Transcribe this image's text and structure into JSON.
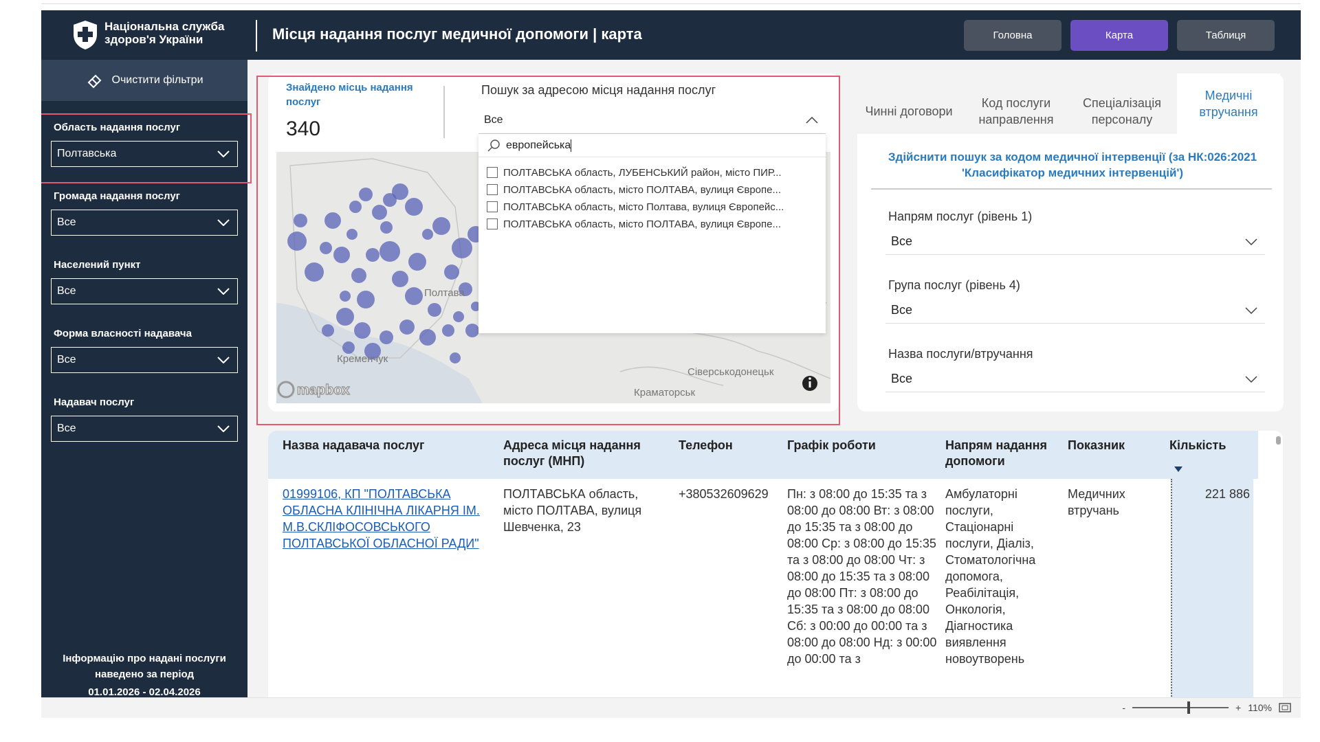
{
  "header": {
    "org_name": "Національна служба здоров'я України",
    "title": "Місця надання послуг медичної допомоги | карта",
    "nav": [
      "Головна",
      "Карта",
      "Таблиця"
    ],
    "active_nav": "Карта"
  },
  "sidebar": {
    "clear_filters": "Очистити фільтри",
    "filters": [
      {
        "label": "Область надання послуг",
        "value": "Полтавська"
      },
      {
        "label": "Громада надання послуг",
        "value": "Все"
      },
      {
        "label": "Населений пункт",
        "value": "Все"
      },
      {
        "label": "Форма власності надавача",
        "value": "Все"
      },
      {
        "label": "Надавач послуг",
        "value": "Все"
      }
    ],
    "period_label": "Інформацію про надані послуги наведено за період",
    "period_value": "01.01.2026 - 02.04.2026"
  },
  "map": {
    "found_label": "Знайдено місць надання послуг",
    "found_value": "340",
    "place_labels": [
      "Полтава",
      "Кременчук",
      "Сіверськодонецьк",
      "Краматорськ"
    ],
    "attribution": "mapbox"
  },
  "address_search": {
    "title": "Пошук за адресою місця надання послуг",
    "selected": "Все",
    "query": "европейська",
    "options": [
      "ПОЛТАВСЬКА область, ЛУБЕНСЬКИЙ район, місто ПИР...",
      "ПОЛТАВСЬКА область, місто ПОЛТАВА, вулиця Європе...",
      "ПОЛТАВСЬКА область, місто Полтава, вулиця Європейс...",
      "ПОЛТАВСЬКА область, місто ПОЛТАВА, вулиця Європе..."
    ]
  },
  "right_panel": {
    "tabs": [
      "Чинні договори",
      "Код послуги направлення",
      "Спеціалізація персоналу",
      "Медичні втручання"
    ],
    "active_tab": "Медичні втручання",
    "code_search": "Здійснити пошук за кодом медичної інтервенції (за НК:026:2021 'Класифікатор медичних інтервенцій')",
    "filters": [
      {
        "label": "Напрям послуг (рівень 1)",
        "value": "Все"
      },
      {
        "label": "Група послуг (рівень 4)",
        "value": "Все"
      },
      {
        "label": "Назва послуги/втручання",
        "value": "Все"
      }
    ]
  },
  "table": {
    "columns": [
      "Назва надавача послуг",
      "Адреса місця надання послуг (МНП)",
      "Телефон",
      "Графік роботи",
      "Напрям надання допомоги",
      "Показник",
      "Кількість"
    ],
    "rows": [
      {
        "provider": "01999106, КП \"ПОЛТАВСЬКА ОБЛАСНА КЛІНІЧНА ЛІКАРНЯ ІМ. М.В.СКЛІФОСОВСЬКОГО ПОЛТАВСЬКОЇ ОБЛАСНОЇ РАДИ\"",
        "address": "ПОЛТАВСЬКА область, місто ПОЛТАВА, вулиця Шевченка, 23",
        "phone": "+380532609629",
        "schedule": "Пн: з 08:00 до 15:35 та з 08:00 до 08:00 Вт: з 08:00 до 15:35 та з 08:00 до 08:00 Ср: з 08:00 до 15:35 та з 08:00 до 08:00 Чт: з 08:00 до 15:35 та з 08:00 до 08:00 Пт: з 08:00 до 15:35 та з 08:00 до 08:00 Сб: з 00:00 до 00:00 та з 08:00 до 08:00 Нд: з 00:00 до 00:00 та з",
        "direction": "Амбулаторні послуги, Стаціонарні послуги, Діаліз, Стоматологічна допомога, Реабілітація, Онкологія, Діагностика виявлення новоутворень",
        "indicator": "Медичних втручань",
        "quantity": "221 886"
      }
    ]
  },
  "footer": {
    "zoom": "110%",
    "zoom_minus": "-",
    "zoom_plus": "+"
  },
  "colors": {
    "header_bg": "#1e2c3f",
    "accent": "#6b4fc2",
    "link": "#2a7bbd",
    "highlight": "#e05a70"
  }
}
